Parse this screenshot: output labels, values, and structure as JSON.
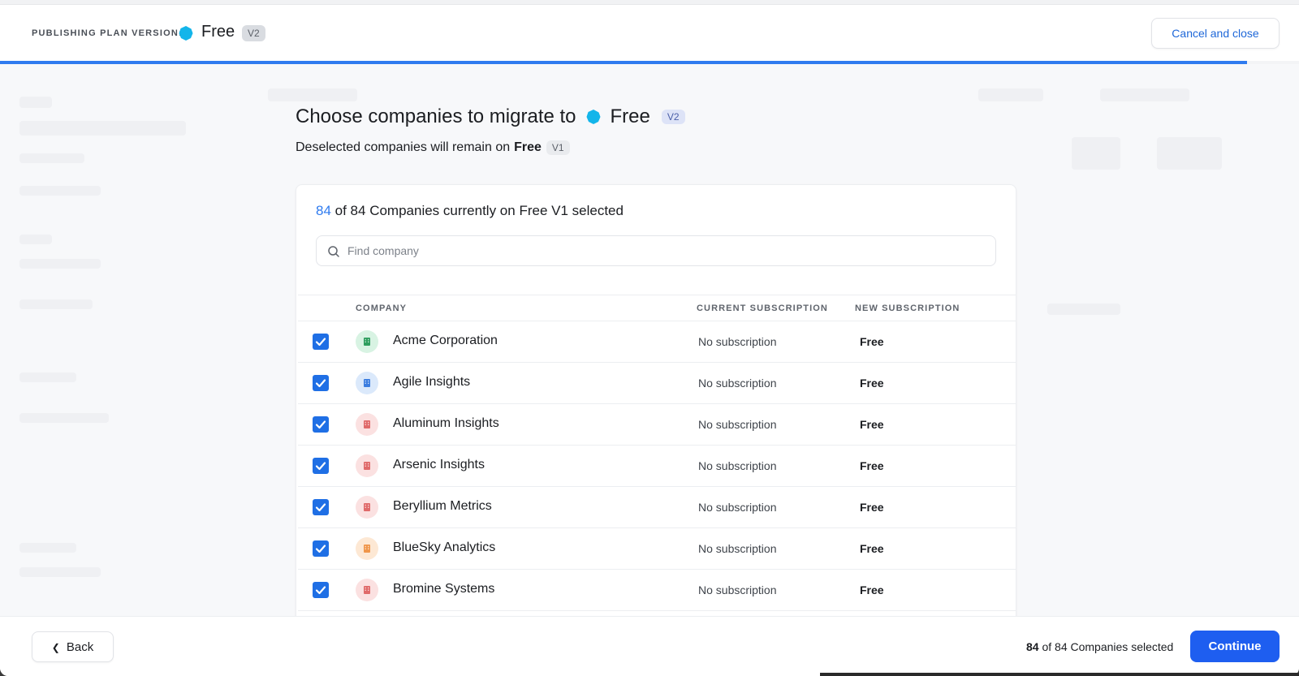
{
  "header": {
    "label": "PUBLISHING PLAN VERSION:",
    "plan_name": "Free",
    "plan_version": "V2",
    "plan_color": "#13b5ea",
    "cancel_label": "Cancel and close",
    "progress_fraction": 0.96
  },
  "main": {
    "title_prefix": "Choose companies to migrate to",
    "title_plan": "Free",
    "title_version": "V2",
    "subtitle_prefix": "Deselected companies will remain on",
    "subtitle_plan": "Free",
    "subtitle_version": "V1"
  },
  "card": {
    "selected_count": "84",
    "count_rest": "of 84 Companies currently on Free V1 selected",
    "search_placeholder": "Find company",
    "columns": {
      "company": "COMPANY",
      "current": "CURRENT SUBSCRIPTION",
      "new": "NEW SUBSCRIPTION"
    },
    "rows": [
      {
        "name": "Acme Corporation",
        "current": "No subscription",
        "new": "Free",
        "logo_bg": "#d8f3e3",
        "logo_fg": "#2e9e5e",
        "checked": true
      },
      {
        "name": "Agile Insights",
        "current": "No subscription",
        "new": "Free",
        "logo_bg": "#dbe9fb",
        "logo_fg": "#3b7de0",
        "checked": true
      },
      {
        "name": "Aluminum Insights",
        "current": "No subscription",
        "new": "Free",
        "logo_bg": "#fbe1e1",
        "logo_fg": "#e06a6a",
        "checked": true
      },
      {
        "name": "Arsenic Insights",
        "current": "No subscription",
        "new": "Free",
        "logo_bg": "#fbe1e1",
        "logo_fg": "#e06a6a",
        "checked": true
      },
      {
        "name": "Beryllium Metrics",
        "current": "No subscription",
        "new": "Free",
        "logo_bg": "#fbe1e1",
        "logo_fg": "#e06a6a",
        "checked": true
      },
      {
        "name": "BlueSky Analytics",
        "current": "No subscription",
        "new": "Free",
        "logo_bg": "#fde8d4",
        "logo_fg": "#f0964a",
        "checked": true
      },
      {
        "name": "Bromine Systems",
        "current": "No subscription",
        "new": "Free",
        "logo_bg": "#fbe1e1",
        "logo_fg": "#e06a6a",
        "checked": true
      }
    ]
  },
  "footer": {
    "back_label": "Back",
    "selected_count": "84",
    "selected_rest": "of 84 Companies selected",
    "continue_label": "Continue"
  },
  "colors": {
    "accent": "#2f7bef",
    "primary_button": "#1e5ef0",
    "checkbox": "#1f6fe5"
  }
}
